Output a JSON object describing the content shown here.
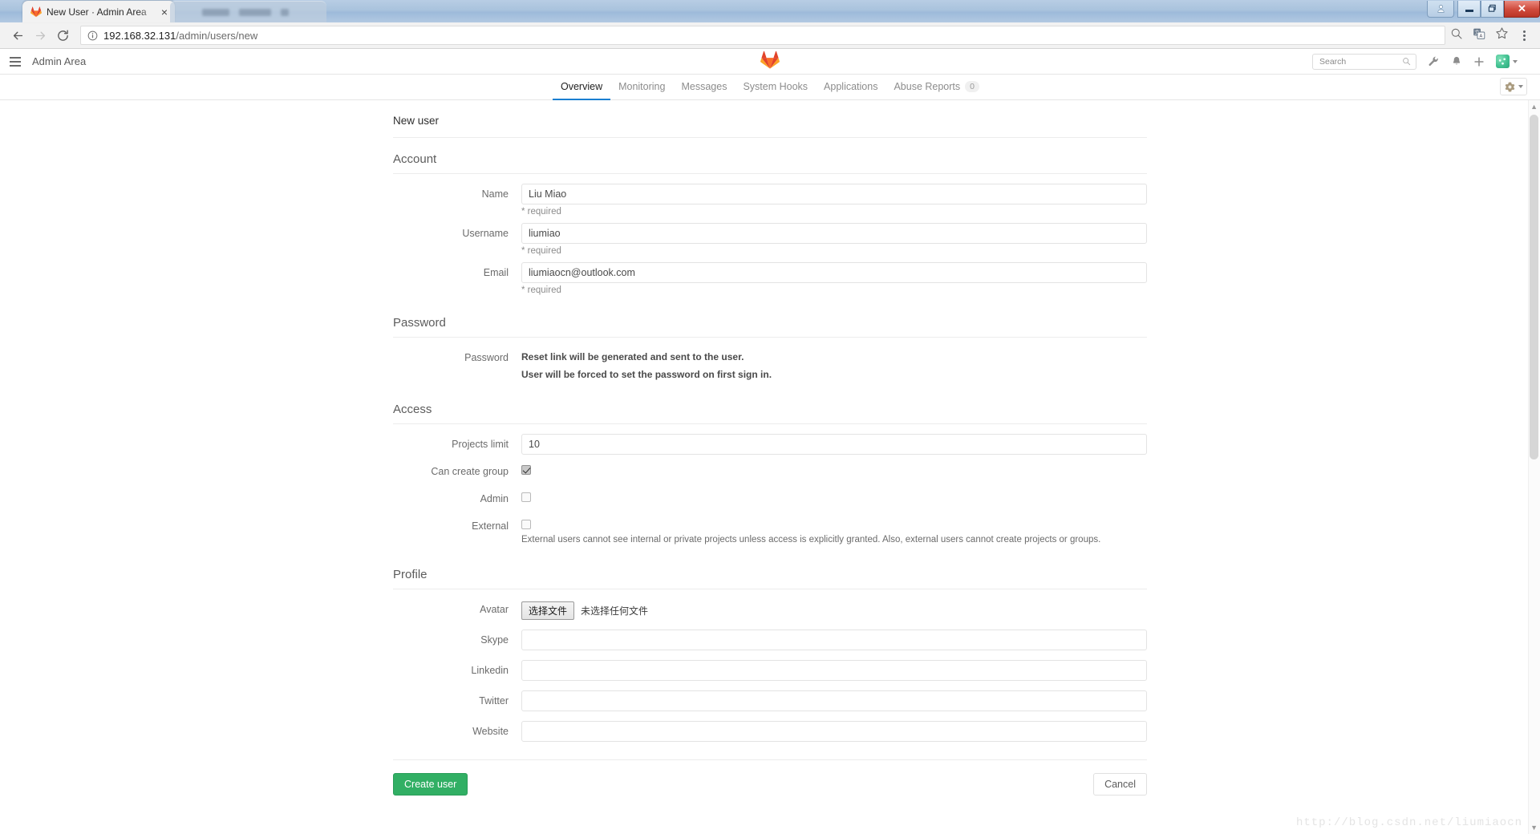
{
  "window": {
    "tab_title": "New User · Admin Area",
    "tab_close_label": "×",
    "minimize_label": "—",
    "restore_label": "❐",
    "close_label": "✕"
  },
  "browser": {
    "url_host": "192.168.32.131",
    "url_path": "/admin/users/new",
    "back_label": "←",
    "forward_label": "→",
    "reload_label": "↻"
  },
  "navbar": {
    "area_title": "Admin Area",
    "search_placeholder": "Search",
    "search_value": ""
  },
  "subnav": {
    "items": [
      {
        "label": "Overview",
        "active": true,
        "badge": ""
      },
      {
        "label": "Monitoring",
        "active": false,
        "badge": ""
      },
      {
        "label": "Messages",
        "active": false,
        "badge": ""
      },
      {
        "label": "System Hooks",
        "active": false,
        "badge": ""
      },
      {
        "label": "Applications",
        "active": false,
        "badge": ""
      },
      {
        "label": "Abuse Reports",
        "active": false,
        "badge": "0"
      }
    ]
  },
  "page": {
    "title": "New user",
    "watermark": "http://blog.csdn.net/liumiaocn"
  },
  "sections": {
    "account": {
      "heading": "Account",
      "name": {
        "label": "Name",
        "value": "Liu Miao",
        "help": "* required"
      },
      "username": {
        "label": "Username",
        "value": "liumiao",
        "help": "* required"
      },
      "email": {
        "label": "Email",
        "value": "liumiaocn@outlook.com",
        "help": "* required"
      }
    },
    "password": {
      "heading": "Password",
      "label": "Password",
      "line1": "Reset link will be generated and sent to the user.",
      "line2": "User will be forced to set the password on first sign in."
    },
    "access": {
      "heading": "Access",
      "projects_limit": {
        "label": "Projects limit",
        "value": "10"
      },
      "can_create_group": {
        "label": "Can create group",
        "checked": true
      },
      "admin": {
        "label": "Admin",
        "checked": false
      },
      "external": {
        "label": "External",
        "checked": false,
        "help": "External users cannot see internal or private projects unless access is explicitly granted. Also, external users cannot create projects or groups."
      }
    },
    "profile": {
      "heading": "Profile",
      "avatar": {
        "label": "Avatar",
        "button_label": "选择文件",
        "file_status": "未选择任何文件"
      },
      "skype": {
        "label": "Skype",
        "value": ""
      },
      "linkedin": {
        "label": "Linkedin",
        "value": ""
      },
      "twitter": {
        "label": "Twitter",
        "value": ""
      },
      "website": {
        "label": "Website",
        "value": ""
      }
    }
  },
  "actions": {
    "create_label": "Create user",
    "cancel_label": "Cancel"
  },
  "colors": {
    "accent_blue": "#1a7fd1",
    "create_green": "#31af64",
    "gitlab_orange": "#fc6d26",
    "close_red": "#cf4a3b"
  }
}
